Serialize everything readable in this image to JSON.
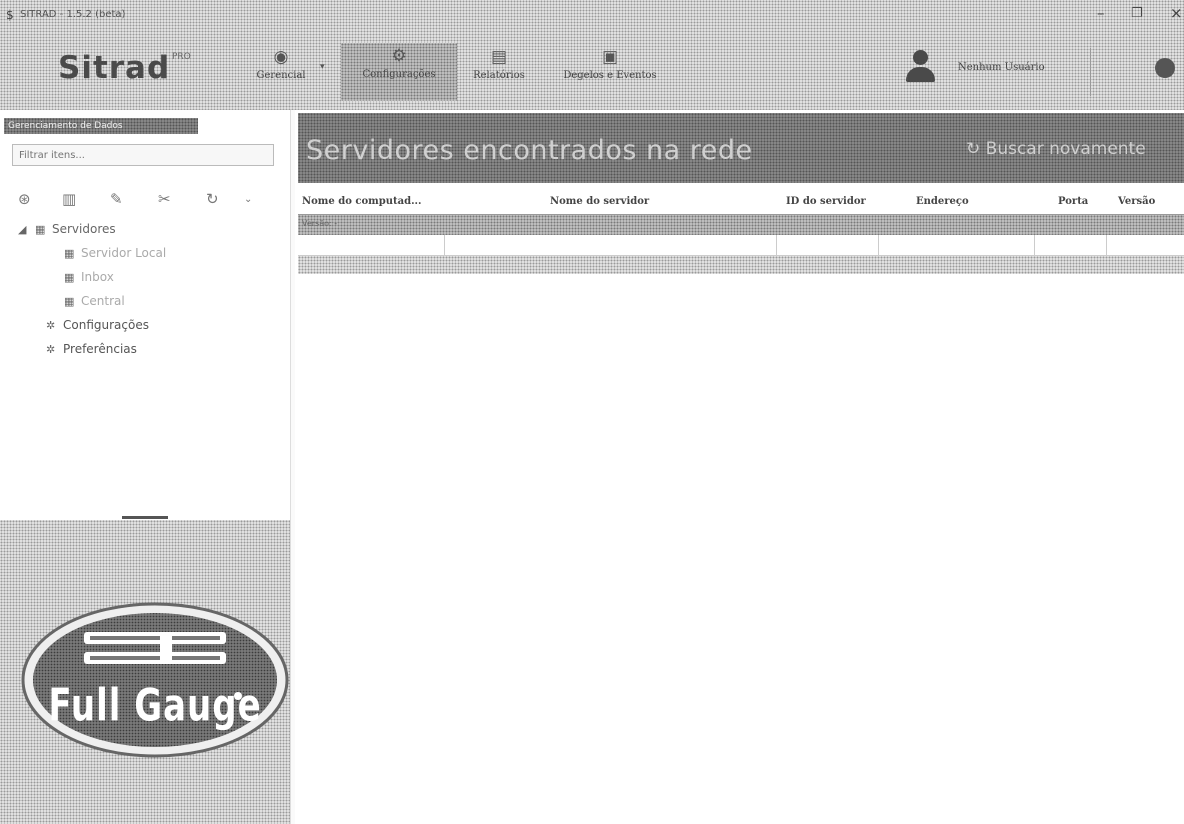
{
  "window": {
    "title": "SITRAD - 1.5.2 (beta)",
    "min_glyph": "–",
    "restore_glyph": "❐",
    "close_glyph": "×"
  },
  "ribbon": {
    "logo_text": "Sitrad",
    "logo_sup": "PRO",
    "buttons": [
      {
        "label": "Gerencial",
        "icon": "eye-icon"
      },
      {
        "label": "Configurações",
        "icon": "gear-icon",
        "active": true
      },
      {
        "label": "Relatórios",
        "icon": "report-icon"
      },
      {
        "label": "Degelos e Eventos",
        "icon": "calendar-icon"
      }
    ],
    "user_name": "Nenhum Usuário"
  },
  "sidebar": {
    "header": "Gerenciamento de Dados",
    "filter_placeholder": "Filtrar itens...",
    "tree": {
      "servidores": "Servidores",
      "local": "Servidor Local",
      "inbox": "Inbox",
      "central": "Central",
      "configuracoes": "Configurações",
      "preferencias": "Preferências"
    },
    "brand_logo_text": "Full Gauge"
  },
  "main": {
    "title": "Servidores encontrados na rede",
    "refresh_label": "Buscar novamente",
    "columns": [
      "Nome do computad...",
      "Nome do servidor",
      "ID do servidor",
      "Endereço",
      "Porta",
      "Versão"
    ],
    "group_label": "Versão: -"
  },
  "colors": {
    "background": "#ffffff",
    "texture_light": "#e9e9e9",
    "texture_dark": "#8c8c8c"
  }
}
